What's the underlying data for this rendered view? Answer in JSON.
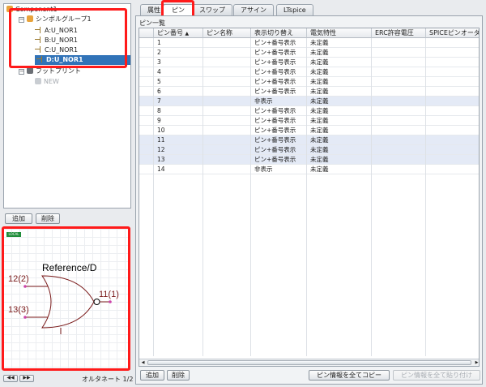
{
  "tree": {
    "root": "Component1",
    "symbol_group": "シンボルグループ1",
    "units": [
      "A:U_NOR1",
      "B:U_NOR1",
      "C:U_NOR1",
      "D:U_NOR1"
    ],
    "selected_index": 3,
    "footprint": "フットプリント",
    "footprint_new": "NEW"
  },
  "left_buttons": {
    "add": "追加",
    "delete": "削除"
  },
  "preview": {
    "badge": "LOCAL",
    "reference_label": "Reference/D",
    "pins": [
      "12(2)",
      "13(3)",
      "11(1)"
    ],
    "alternate": "オルタネート 1/2"
  },
  "tabs": [
    "属性",
    "ピン",
    "スワップ",
    "アサイン",
    "LTspice"
  ],
  "active_tab": 1,
  "section_title": "ピン一覧",
  "table": {
    "columns": [
      "ピン番号",
      "ピン名称",
      "表示切り替え",
      "電気特性",
      "ERC許容電圧",
      "SPICEピンオーダー"
    ],
    "rows": [
      [
        "1",
        "",
        "ピン+番号表示",
        "未定義"
      ],
      [
        "2",
        "",
        "ピン+番号表示",
        "未定義"
      ],
      [
        "3",
        "",
        "ピン+番号表示",
        "未定義"
      ],
      [
        "4",
        "",
        "ピン+番号表示",
        "未定義"
      ],
      [
        "5",
        "",
        "ピン+番号表示",
        "未定義"
      ],
      [
        "6",
        "",
        "ピン+番号表示",
        "未定義"
      ],
      [
        "7",
        "",
        "非表示",
        "未定義"
      ],
      [
        "8",
        "",
        "ピン+番号表示",
        "未定義"
      ],
      [
        "9",
        "",
        "ピン+番号表示",
        "未定義"
      ],
      [
        "10",
        "",
        "ピン+番号表示",
        "未定義"
      ],
      [
        "11",
        "",
        "ピン+番号表示",
        "未定義"
      ],
      [
        "12",
        "",
        "ピン+番号表示",
        "未定義"
      ],
      [
        "13",
        "",
        "ピン+番号表示",
        "未定義"
      ],
      [
        "14",
        "",
        "非表示",
        "未定義"
      ]
    ],
    "highlight_rows": [
      6,
      10,
      11,
      12
    ]
  },
  "right_buttons": {
    "add": "追加",
    "delete": "削除",
    "copy_all": "ピン情報を全てコピー",
    "paste_all": "ピン情報を全て貼り付け"
  },
  "colors": {
    "selection": "#3173b8",
    "highlight": "#e4eaf6",
    "annotation": "#ff1a1a"
  }
}
